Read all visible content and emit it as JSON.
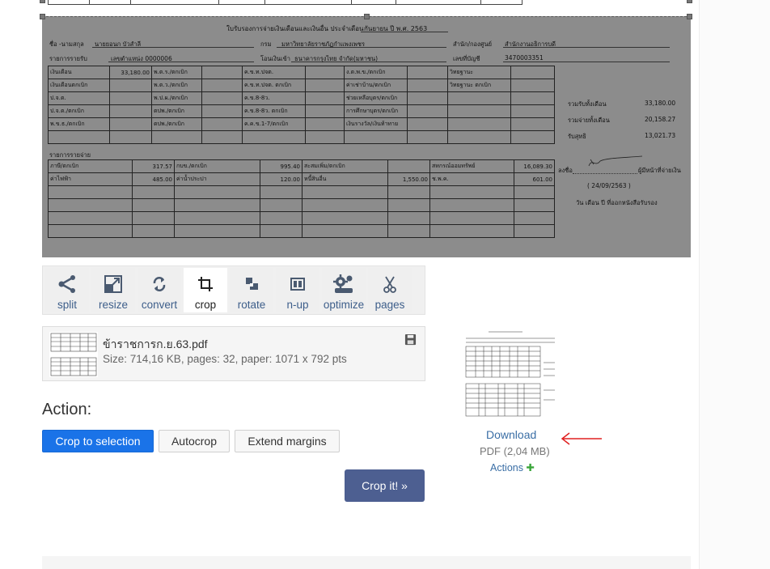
{
  "document": {
    "title": "ใบรับรองการจ่ายเงินเดือนและเงินอื่น ประจำเดือน",
    "month": "กันยายน ปี พ.ศ. 2563",
    "name_label": "ชื่อ -นามสกุล",
    "name_value": "นายยอนก บัวสำลี",
    "dept_label": "กรม",
    "dept_value": "มหาวิทยาลัยราชภัฏกำแพงเพชร",
    "office_label": "สำนัก/กองศูนย์",
    "office_value": "สำนักงานอธิการบดี",
    "detail_label": "รายการรายรับ",
    "position_no": "เลขตำแหน่ง 0000006",
    "bank_label": "โอนเงินเข้า",
    "bank_value": "ธนาคารกรุงไทย จำกัด(มหาชน)",
    "account_label": "เลขที่บัญชี",
    "account_value": "3470003351",
    "income_rows": [
      [
        "เงินเดือน",
        "33,180.00",
        "พ.ต.ร./ตกเบิก",
        "",
        "ค.ข.ท.ปจต.",
        "",
        "ง.ต.พ.ข./ตกเบิก",
        "",
        "วิทยฐานะ",
        ""
      ],
      [
        "เงินเดือนตกเบิก",
        "",
        "พ.ต.ว./ตกเบิก",
        "",
        "ค.ข.ท.ปจต. ตกเบิก",
        "",
        "ค่าเช่าบ้าน/ตกเบิก",
        "",
        "วิทยฐานะ ตกเบิก",
        ""
      ],
      [
        "ป.จ.ต.",
        "",
        "พ.ป.ผ./ตกเบิก",
        "",
        "ค.ข.8-8ว.",
        "",
        "ช่วยเหลือบุตร/ตกเบิก",
        "",
        "",
        ""
      ],
      [
        "ป.จ.ต./ตกเบิก",
        "",
        "ตปพ./ตกเบิก",
        "",
        "ค.ข.8-8ว. ตกเบิก",
        "",
        "การศึกษาบุตร/ตกเบิก",
        "",
        "",
        ""
      ],
      [
        "พ.ข.ธ./ตกเบิก",
        "",
        "ตปพ./ตกเบิก",
        "",
        "ค.ค.ข.1-7/ตกเบิก",
        "",
        "เงินรางวัล/เงินท้าทาย",
        "",
        "",
        ""
      ],
      [
        "",
        "",
        "",
        "",
        "",
        "",
        "",
        "",
        "",
        ""
      ]
    ],
    "summary": [
      {
        "label": "รวมรับทั้งเดือน",
        "value": "33,180.00"
      },
      {
        "label": "รวมจ่ายทั้งเดือน",
        "value": "20,158.27"
      },
      {
        "label": "รับสุทธิ",
        "value": "13,021.73"
      }
    ],
    "expense_label": "รายการรายจ่าย",
    "expense_rows": [
      [
        "ภาษี/ตกเบิก",
        "317.57",
        "กบข./ตกเบิก",
        "995.40",
        "สะสมเพิ่ม/ตกเบิก",
        "",
        "สหกรณ์ออมทรัพย์",
        "16,089.30"
      ],
      [
        "ค่าไฟฟ้า",
        "485.00",
        "ค่าน้ำประปา",
        "120.00",
        "หนี้สินอื่น",
        "1,550.00",
        "ช.พ.ค.",
        "601.00"
      ],
      [
        "",
        "",
        "",
        "",
        "",
        "",
        "",
        ""
      ],
      [
        "",
        "",
        "",
        "",
        "",
        "",
        "",
        ""
      ],
      [
        "",
        "",
        "",
        "",
        "",
        "",
        "",
        ""
      ],
      [
        "",
        "",
        "",
        "",
        "",
        "",
        "",
        ""
      ]
    ],
    "sign_label": "ลงชื่อ",
    "payer_label": "ผู้มีหน้าที่จ่ายเงิน",
    "sign_date": "( 24/09/2563 )",
    "issue_label": "วัน เดือน ปี ที่ออกหนังสือรับรอง"
  },
  "tools": [
    {
      "name": "split",
      "label": "split",
      "icon": "split-icon"
    },
    {
      "name": "resize",
      "label": "resize",
      "icon": "resize-icon"
    },
    {
      "name": "convert",
      "label": "convert",
      "icon": "convert-icon"
    },
    {
      "name": "crop",
      "label": "crop",
      "icon": "crop-icon",
      "active": true
    },
    {
      "name": "rotate",
      "label": "rotate",
      "icon": "rotate-icon"
    },
    {
      "name": "n-up",
      "label": "n-up",
      "icon": "n-up-icon"
    },
    {
      "name": "optimize",
      "label": "optimize",
      "icon": "optimize-icon"
    },
    {
      "name": "pages",
      "label": "pages",
      "icon": "scissors-icon"
    }
  ],
  "file": {
    "name": "ข้าราชการก.ย.63.pdf",
    "meta": "Size: 714,16 KB, pages: 32, paper: 1071 x 792 pts"
  },
  "action": {
    "heading": "Action:",
    "crop_to_selection": "Crop to selection",
    "autocrop": "Autocrop",
    "extend_margins": "Extend margins",
    "crop_it": "Crop it! »"
  },
  "download": {
    "label": "Download",
    "meta": "PDF (2,04 MB)",
    "actions": "Actions"
  },
  "colors": {
    "primary": "#1a73e8",
    "crop_button": "#4d5f91",
    "link": "#3a6ea5",
    "arrow": "#e02020"
  }
}
